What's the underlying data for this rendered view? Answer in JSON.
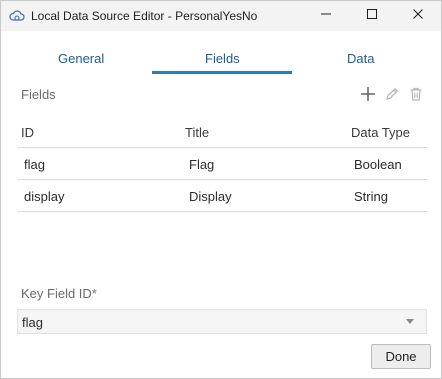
{
  "window": {
    "title": "Local Data Source Editor - PersonalYesNo",
    "app_icon": "cloud-data-icon",
    "controls": [
      "minimize-icon",
      "maximize-icon",
      "close-icon"
    ]
  },
  "tabs": [
    {
      "label": "General",
      "active": false
    },
    {
      "label": "Fields",
      "active": true
    },
    {
      "label": "Data",
      "active": false
    }
  ],
  "fields_section": {
    "label": "Fields",
    "toolbar": [
      "add-icon",
      "edit-icon",
      "delete-icon"
    ]
  },
  "table": {
    "columns": [
      "ID",
      "Title",
      "Data Type"
    ],
    "rows": [
      {
        "id": "flag",
        "title": "Flag",
        "type": "Boolean"
      },
      {
        "id": "display",
        "title": "Display",
        "type": "String"
      }
    ]
  },
  "key_field": {
    "label": "Key Field ID*",
    "value": "flag"
  },
  "footer": {
    "done_label": "Done"
  },
  "colors": {
    "accent": "#2b7bbd",
    "tab_text": "#1d5d8f",
    "title_bar": "#f3f3f3"
  }
}
